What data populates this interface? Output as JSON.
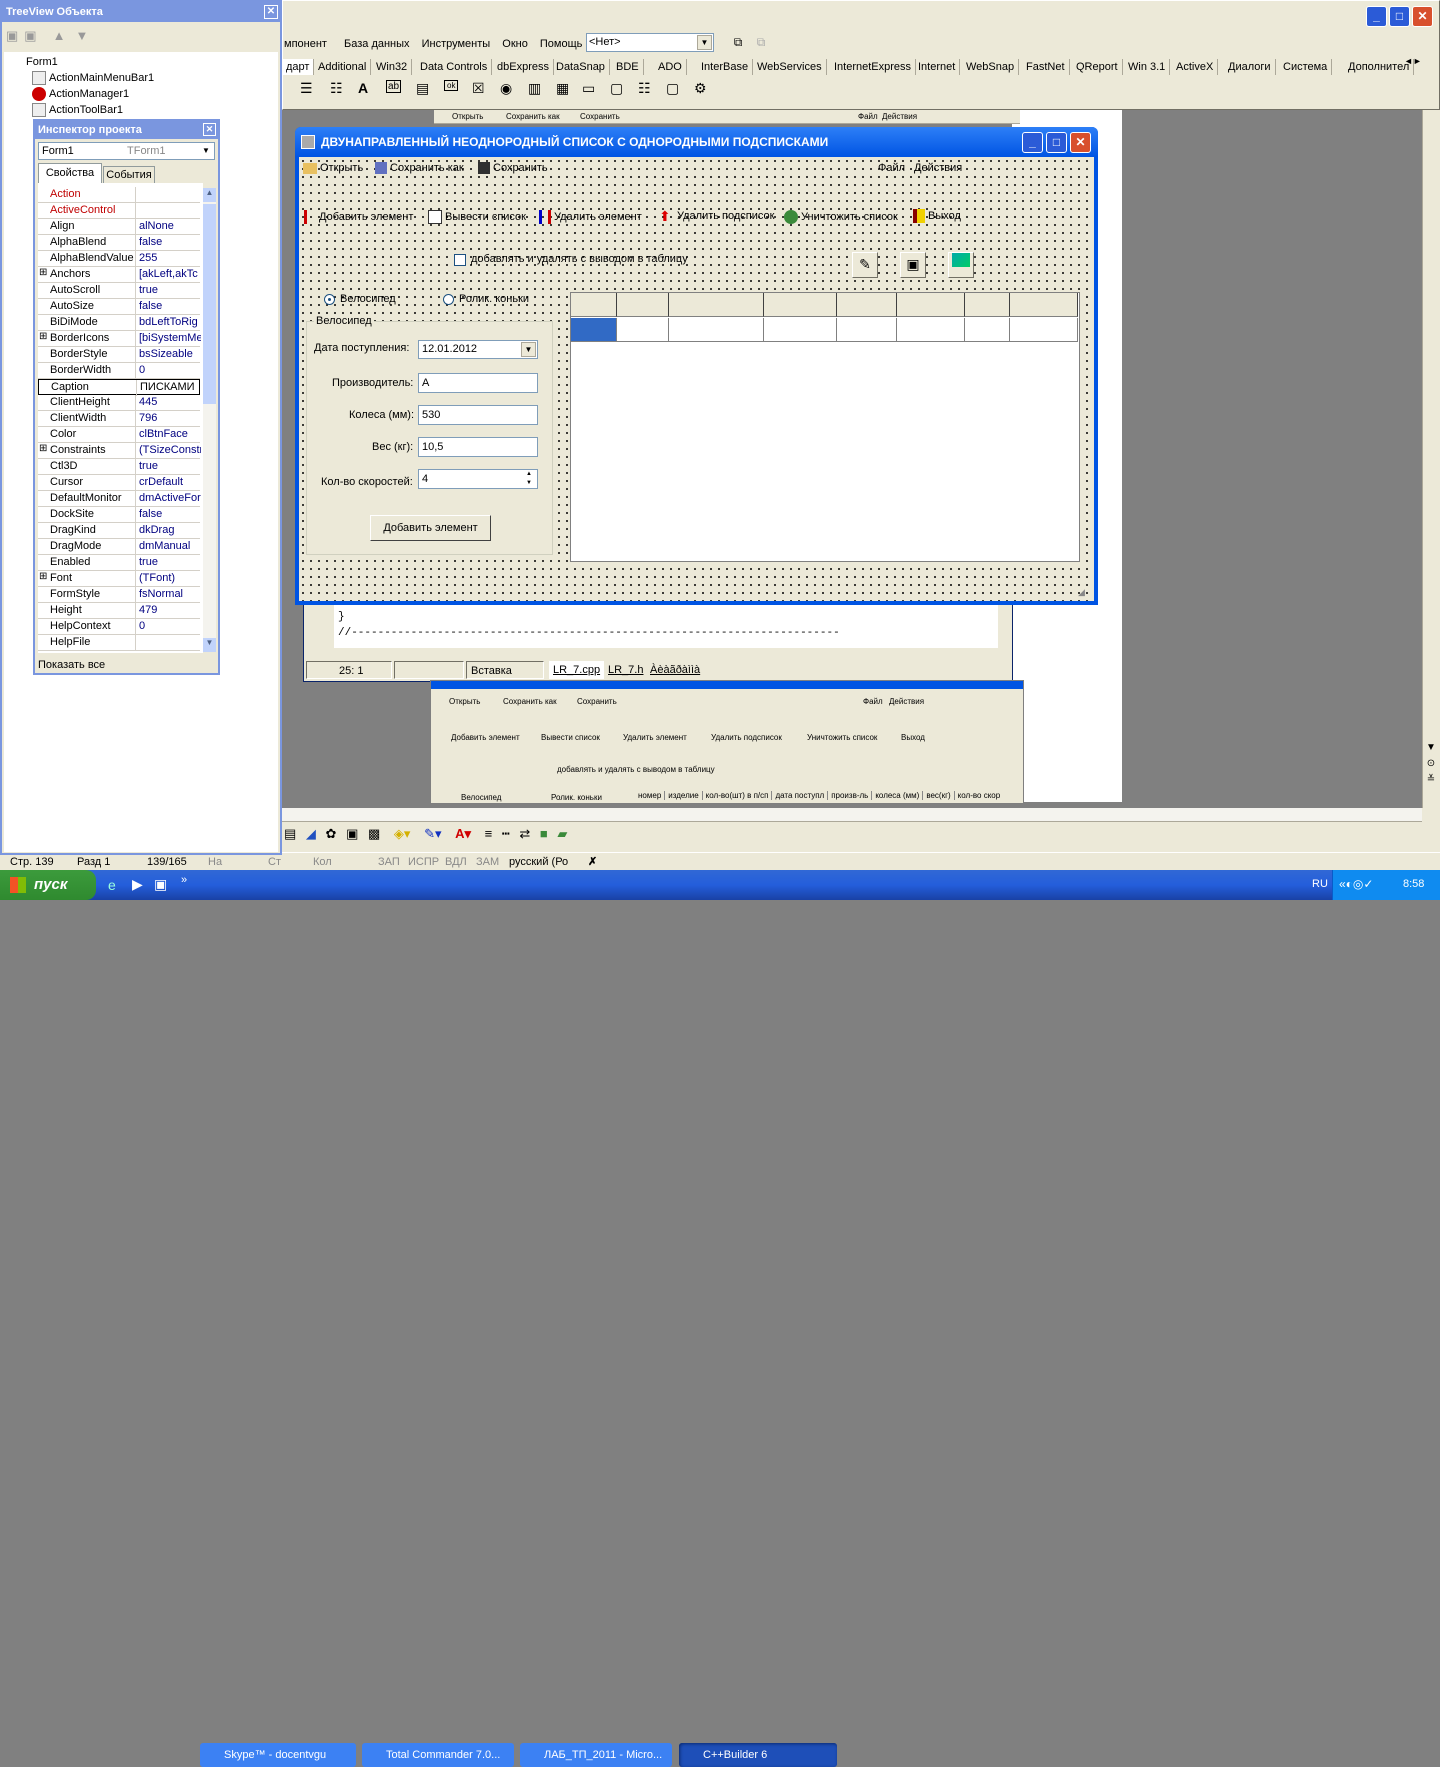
{
  "treeview": {
    "title": "TreeView Объекта",
    "items": [
      "Form1",
      "ActionMainMenuBar1",
      "ActionManager1",
      "ActionToolBar1"
    ]
  },
  "ide": {
    "menu": [
      "мпонент",
      "База данных",
      "Инструменты",
      "Окно",
      "Помощь"
    ],
    "combo_value": "<Нет>",
    "palette_tabs": [
      "дарт",
      "Additional",
      "Win32",
      "Data Controls",
      "dbExpress",
      "DataSnap",
      "BDE",
      "ADO",
      "InterBase",
      "WebServices",
      "InternetExpress",
      "Internet",
      "WebSnap",
      "FastNet",
      "QReport",
      "Win 3.1",
      "ActiveX",
      "Диалоги",
      "Система",
      "Дополнител"
    ],
    "back_form_actions": [
      "Открыть",
      "Сохранить как",
      "Сохранить"
    ],
    "back_form_menu": [
      "Файл",
      "Действия"
    ]
  },
  "inspector": {
    "title": "Инспектор проекта",
    "object": "Form1",
    "object_type": "TForm1",
    "tabs": [
      "Свойства",
      "События"
    ],
    "properties": [
      {
        "name": "Action",
        "value": "",
        "red": true,
        "exp": false
      },
      {
        "name": "ActiveControl",
        "value": "",
        "red": true,
        "exp": false
      },
      {
        "name": "Align",
        "value": "alNone",
        "exp": false
      },
      {
        "name": "AlphaBlend",
        "value": "false",
        "exp": false
      },
      {
        "name": "AlphaBlendValue",
        "value": "255",
        "exp": false
      },
      {
        "name": "Anchors",
        "value": "[akLeft,akTc",
        "exp": true
      },
      {
        "name": "AutoScroll",
        "value": "true",
        "exp": false
      },
      {
        "name": "AutoSize",
        "value": "false",
        "exp": false
      },
      {
        "name": "BiDiMode",
        "value": "bdLeftToRig",
        "exp": false
      },
      {
        "name": "BorderIcons",
        "value": "[biSystemMe",
        "exp": true
      },
      {
        "name": "BorderStyle",
        "value": "bsSizeable",
        "exp": false
      },
      {
        "name": "BorderWidth",
        "value": "0",
        "exp": false
      },
      {
        "name": "Caption",
        "value": "ПИСКАМИ",
        "exp": false,
        "selected": true
      },
      {
        "name": "ClientHeight",
        "value": "445",
        "exp": false
      },
      {
        "name": "ClientWidth",
        "value": "796",
        "exp": false
      },
      {
        "name": "Color",
        "value": "clBtnFace",
        "exp": false
      },
      {
        "name": "Constraints",
        "value": "(TSizeConstr",
        "exp": true
      },
      {
        "name": "Ctl3D",
        "value": "true",
        "exp": false
      },
      {
        "name": "Cursor",
        "value": "crDefault",
        "exp": false
      },
      {
        "name": "DefaultMonitor",
        "value": "dmActiveFor",
        "exp": false
      },
      {
        "name": "DockSite",
        "value": "false",
        "exp": false
      },
      {
        "name": "DragKind",
        "value": "dkDrag",
        "exp": false
      },
      {
        "name": "DragMode",
        "value": "dmManual",
        "exp": false
      },
      {
        "name": "Enabled",
        "value": "true",
        "exp": false
      },
      {
        "name": "Font",
        "value": "(TFont)",
        "exp": true
      },
      {
        "name": "FormStyle",
        "value": "fsNormal",
        "exp": false
      },
      {
        "name": "Height",
        "value": "479",
        "exp": false
      },
      {
        "name": "HelpContext",
        "value": "0",
        "exp": false
      },
      {
        "name": "HelpFile",
        "value": "",
        "exp": false
      }
    ],
    "footer": "Показать все"
  },
  "form": {
    "title": "ДВУНАПРАВЛЕННЫЙ  НЕОДНОРОДНЫЙ  СПИСОК  С  ОДНОРОДНЫМИ  ПОДСПИСКАМИ",
    "menu_left": [
      "Открыть",
      "Сохранить как",
      "Сохранить"
    ],
    "menu_right": [
      "Файл",
      "Действия"
    ],
    "actions": [
      "Добавить элемент",
      "Вывести список",
      "Удалить элемент",
      "Удалить подсписок",
      "Уничтожить список",
      "Выход"
    ],
    "checkbox_label": "добавлять и удалять с выводом в таблицу",
    "radio1": "Велосипед",
    "radio2": "Ролик. коньки",
    "group_title": "Велосипед",
    "labels": {
      "date": "Дата поступления:",
      "maker": "Производитель:",
      "wheels": "Колеса (мм):",
      "weight": "Вес (кг):",
      "speeds": "Кол-во скоростей:"
    },
    "values": {
      "date": "12.01.2012",
      "maker": "A",
      "wheels": "530",
      "weight": "10,5",
      "speeds": "4"
    },
    "add_button": "Добавить элемент"
  },
  "editor": {
    "code_lines": [
      "}",
      "//--------------------------------------------------------------------------"
    ],
    "status_pos": "25:  1",
    "status_mode": "Вставка",
    "tabs": [
      "LR_7.cpp",
      "LR_7.h",
      "Àèàãðàììà"
    ]
  },
  "preview": {
    "menu_left": [
      "Открыть",
      "Сохранить как",
      "Сохранить"
    ],
    "menu_right": [
      "Файл",
      "Действия"
    ],
    "actions": [
      "Добавить элемент",
      "Вывести список",
      "Удалить элемент",
      "Удалить подсписок",
      "Уничтожить список",
      "Выход"
    ],
    "checkbox_label": "добавлять и удалять с выводом в таблицу",
    "radio1": "Велосипед",
    "radio2": "Ролик. коньки",
    "columns": [
      "номер",
      "изделие",
      "кол-во(шт) в п/сп",
      "дата поступл",
      "произв-ль",
      "колеса (мм)",
      "вес(кг)",
      "кол-во скор"
    ]
  },
  "word_status": {
    "page": "Стр. 139",
    "section": "Разд 1",
    "pages": "139/165",
    "at": "На",
    "line": "Ст",
    "col": "Кол",
    "rec": "ЗАП",
    "trk": "ИСПР",
    "ext": "ВДЛ",
    "ovr": "ЗАМ",
    "lang": "русский (Ро"
  },
  "taskbar": {
    "start": "пуск",
    "tasks": [
      "Skype™ - docentvgu",
      "Total Commander 7.0...",
      "ЛАБ_ТП_2011 - Micro...",
      "C++Builder 6"
    ],
    "lang": "RU",
    "time": "8:58"
  }
}
